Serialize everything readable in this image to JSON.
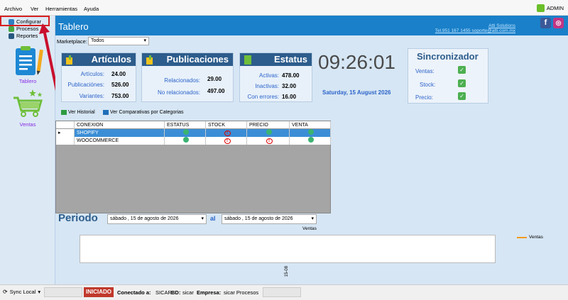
{
  "menubar": {
    "items": [
      "Archivo",
      "Ver",
      "Herramientas",
      "Ayuda"
    ],
    "user": "ADMIN"
  },
  "sidebar": {
    "menu": [
      {
        "label": "Configurar",
        "icon": "gear-icon"
      },
      {
        "label": "Procesos",
        "icon": "process-icon"
      },
      {
        "label": "Reportes",
        "icon": "report-icon"
      }
    ],
    "nav": [
      {
        "label": "Tablero",
        "icon": "clipboard-icon"
      },
      {
        "label": "Ventas",
        "icon": "cart-icon"
      }
    ]
  },
  "header": {
    "title": "Tablero",
    "company": "Atti Solutions",
    "contact": "Tel.951 167 1455  soporte@atti.com.mx",
    "social": [
      "f",
      "◎"
    ]
  },
  "marketplace": {
    "label": "Marketplace:",
    "value": "Todos"
  },
  "articulos": {
    "title": "Artículos",
    "rows": [
      {
        "label": "Artículos:",
        "value": "24.00"
      },
      {
        "label": "Publicaciónes:",
        "value": "526.00"
      },
      {
        "label": "Variantes:",
        "value": "753.00"
      }
    ]
  },
  "publicaciones": {
    "title": "Publicaciones",
    "rows": [
      {
        "label": "Relacionados:",
        "value": "29.00"
      },
      {
        "label": "No relacionados:",
        "value": "497.00"
      }
    ]
  },
  "estatus": {
    "title": "Estatus",
    "rows": [
      {
        "label": "Activas:",
        "value": "478.00"
      },
      {
        "label": "Inactivas:",
        "value": "32.00"
      },
      {
        "label": "Con errores:",
        "value": "16.00"
      }
    ]
  },
  "clock": {
    "time": "09:26:01",
    "date": "Saturday, 15 August 2026"
  },
  "sincronizador": {
    "title": "Sincronizador",
    "rows": [
      {
        "label": "Ventas:",
        "ok": true
      },
      {
        "label": "Stock:",
        "ok": true
      },
      {
        "label": "Precio:",
        "ok": true
      }
    ]
  },
  "grid_tabs": [
    "Ver Historial",
    "Ver Comparativas por Categorias"
  ],
  "grid": {
    "columns": [
      "CONEXION",
      "ESTATUS",
      "STOCK",
      "PRECIO",
      "VENTA"
    ],
    "rows": [
      {
        "conexion": "SHOPIFY",
        "estatus": "ok",
        "stock": "error",
        "precio": "ok",
        "venta": "ok",
        "selected": true
      },
      {
        "conexion": "WOOCOMMERCE",
        "estatus": "ok",
        "stock": "error",
        "precio": "error",
        "venta": "ok",
        "selected": false
      }
    ]
  },
  "periodo": {
    "label": "Periodo",
    "from": "sábado , 15 de   agosto   de 2026",
    "al": "al",
    "to": "sábado , 15 de   agosto   de 2026"
  },
  "chart_data": {
    "type": "line",
    "title": "Ventas",
    "x": [
      "15-08"
    ],
    "series": [
      {
        "name": "Ventas",
        "values": []
      }
    ],
    "legend": "right"
  },
  "status_bar": {
    "sync": "Sync Local",
    "state": "INICIADO",
    "conectado_label": "Conectado a:",
    "conectado_value": "SICAR",
    "bd_label": "BD:",
    "bd_value": "sicar",
    "empresa_label": "Empresa:",
    "empresa_value": "sicar Procesos"
  },
  "colors": {
    "header": "#1a80c9",
    "panel_head": "#2d5d8c",
    "link": "#2c63c9",
    "ok": "#4caf50",
    "error": "#dd0000",
    "iniciado": "#c0392b"
  }
}
